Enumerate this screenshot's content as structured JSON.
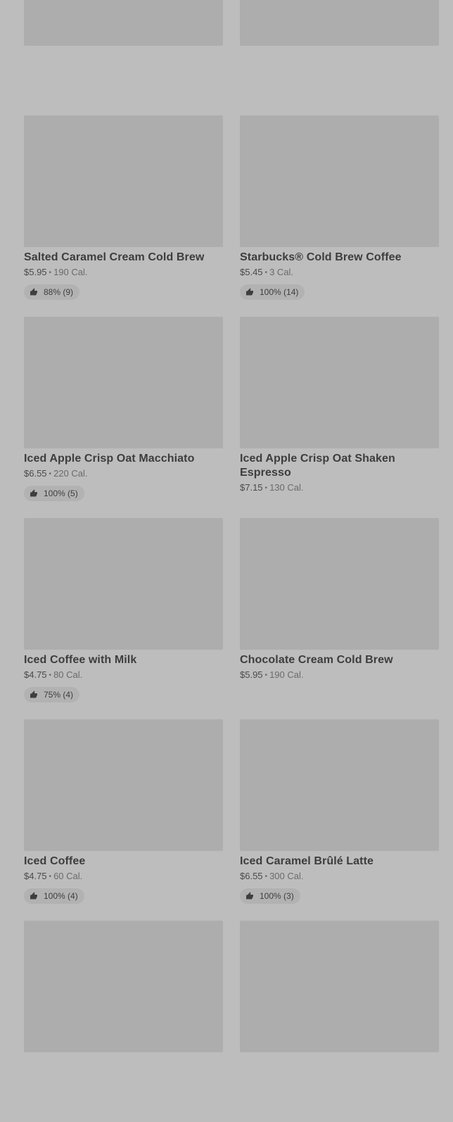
{
  "products": [
    {
      "image": "product-image",
      "name": "",
      "price": "",
      "calories": "",
      "rating": ""
    },
    {
      "image": "product-image",
      "name": "",
      "price": "",
      "calories": "",
      "rating": ""
    },
    {
      "image": "product-image",
      "name": "Salted Caramel Cream Cold Brew",
      "price": "$5.95",
      "calories": "190 Cal.",
      "rating": "88% (9)"
    },
    {
      "image": "product-image",
      "name": "Starbucks® Cold Brew Coffee",
      "price": "$5.45",
      "calories": "3 Cal.",
      "rating": "100% (14)"
    },
    {
      "image": "product-image",
      "name": "Iced Apple Crisp Oat Macchiato",
      "price": "$6.55",
      "calories": "220 Cal.",
      "rating": "100% (5)"
    },
    {
      "image": "product-image",
      "name": "Iced Apple Crisp Oat Shaken Espresso",
      "price": "$7.15",
      "calories": "130 Cal.",
      "rating": ""
    },
    {
      "image": "product-image",
      "name": "Iced Coffee with Milk",
      "price": "$4.75",
      "calories": "80 Cal.",
      "rating": "75% (4)"
    },
    {
      "image": "product-image",
      "name": "Chocolate Cream Cold Brew",
      "price": "$5.95",
      "calories": "190 Cal.",
      "rating": ""
    },
    {
      "image": "product-image",
      "name": "Iced Coffee",
      "price": "$4.75",
      "calories": "60 Cal.",
      "rating": "100% (4)"
    },
    {
      "image": "product-image",
      "name": "Iced Caramel Brûlé Latte",
      "price": "$6.55",
      "calories": "300 Cal.",
      "rating": "100% (3)"
    },
    {
      "image": "product-image",
      "name": "",
      "price": "",
      "calories": "",
      "rating": ""
    },
    {
      "image": "product-image",
      "name": "",
      "price": "",
      "calories": "",
      "rating": ""
    }
  ],
  "separator": "•",
  "icons": {
    "rating": "thumbs-up-icon"
  },
  "colors": {
    "background": "#bdbdbd",
    "image_placeholder": "#adadad",
    "rating_pill": "#b2b2b2"
  }
}
